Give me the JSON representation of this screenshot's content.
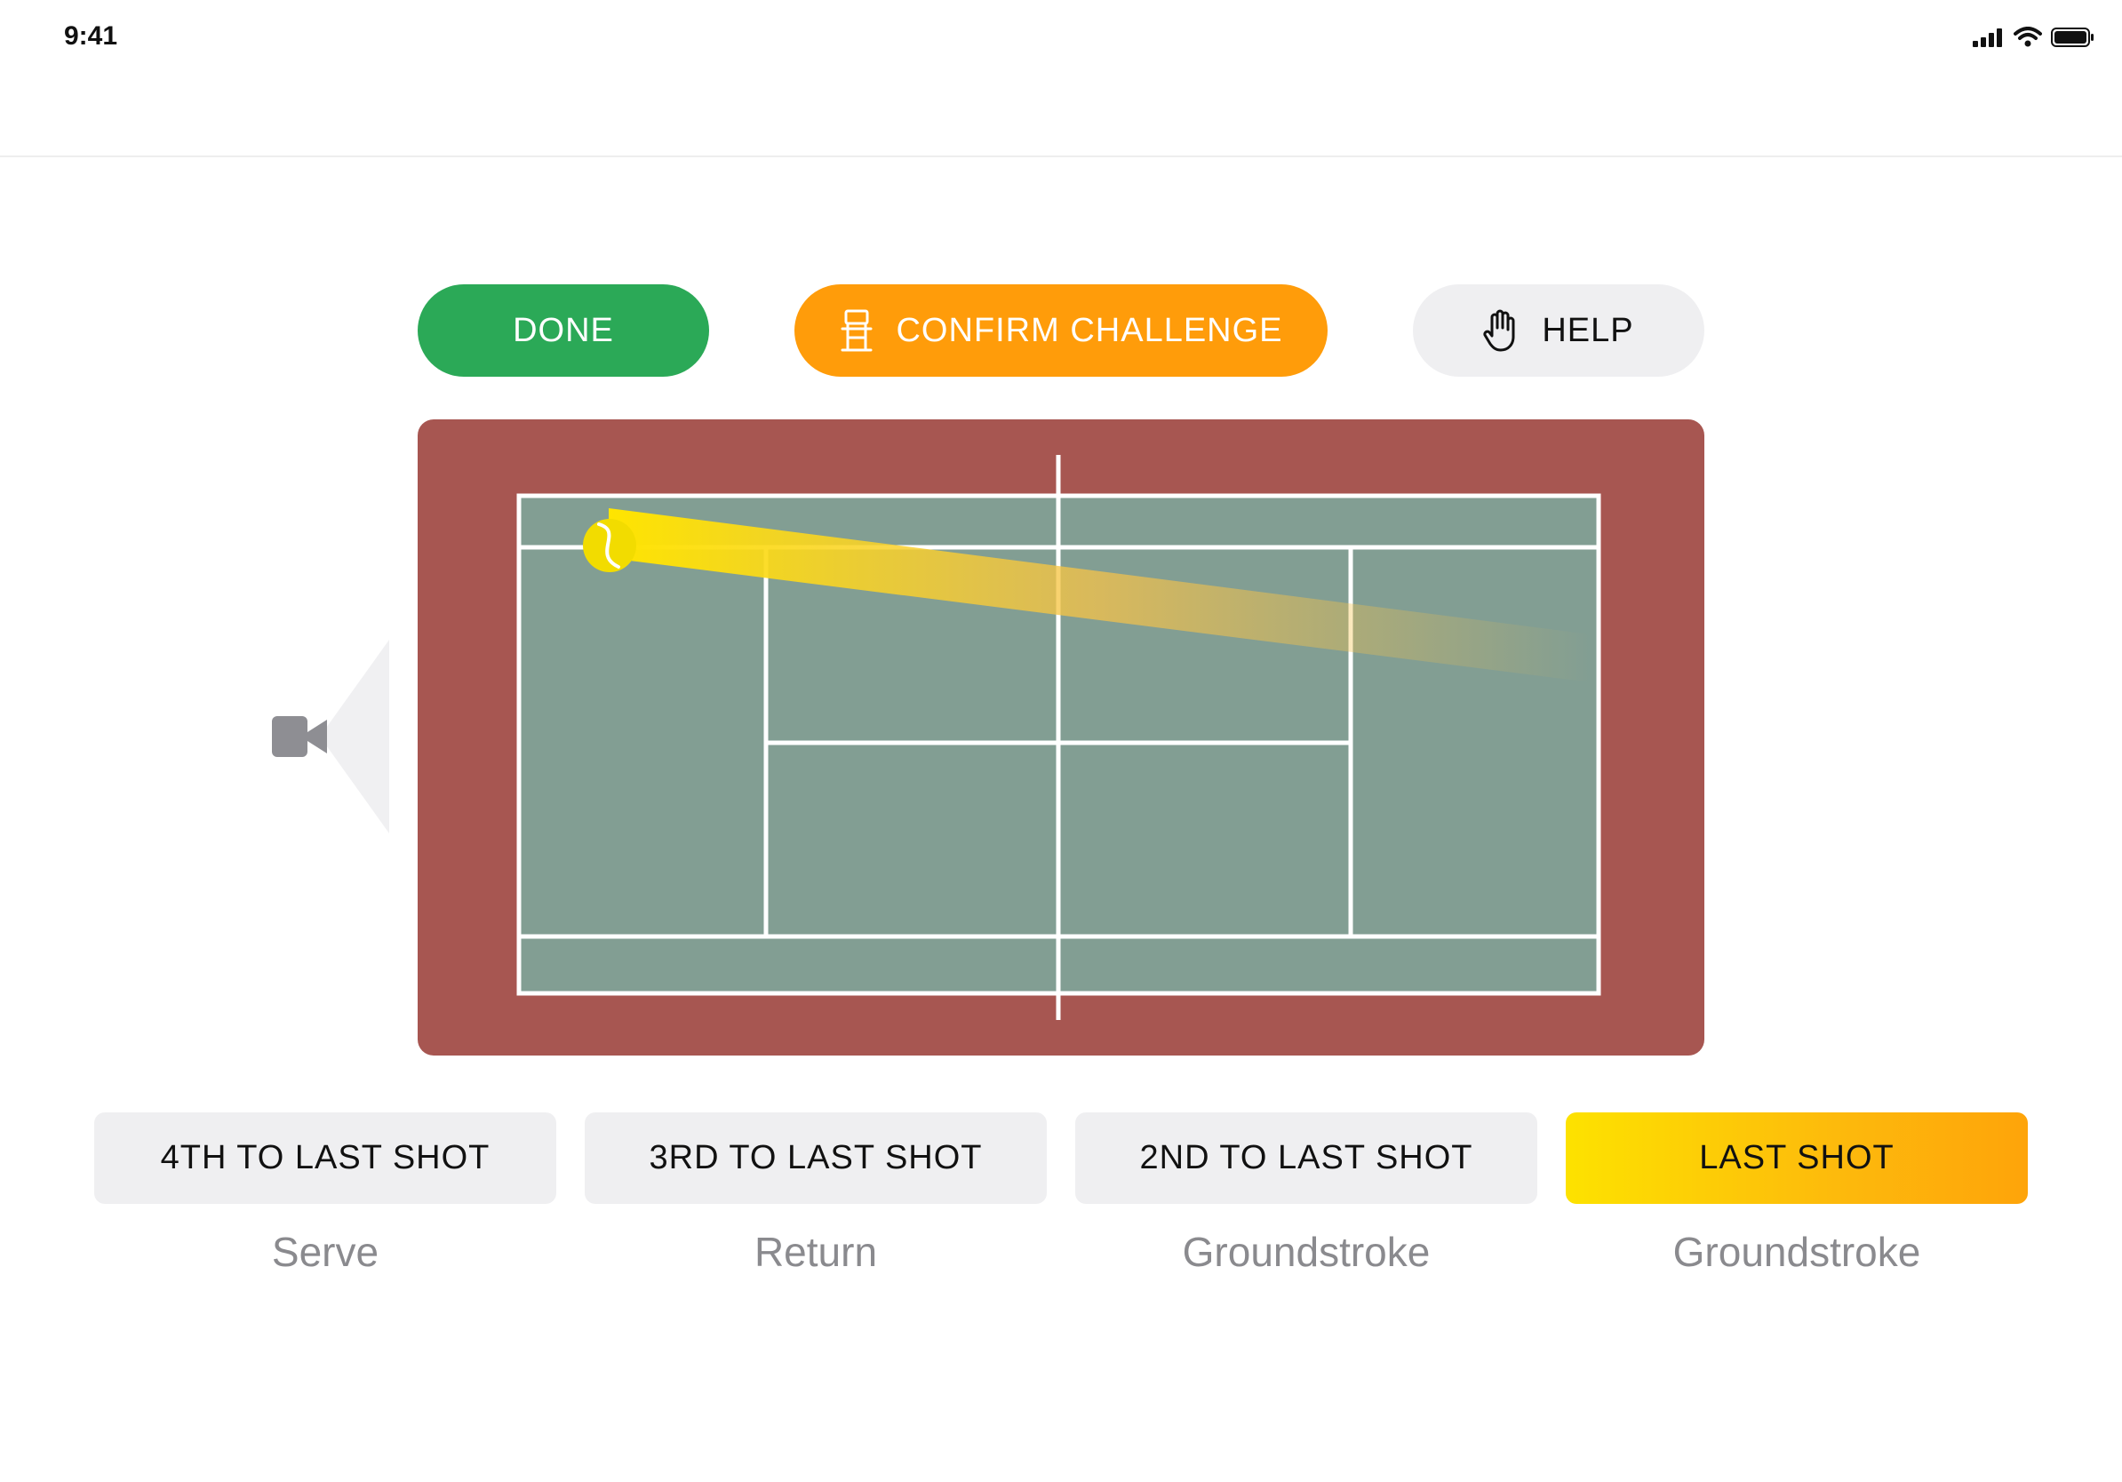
{
  "status_bar": {
    "time": "9:41"
  },
  "toolbar": {
    "done_label": "DONE",
    "confirm_label": "CONFIRM CHALLENGE",
    "help_label": "HELP"
  },
  "court": {
    "colors": {
      "surround": "#a75651",
      "surface": "#829e93",
      "lines": "#ffffff",
      "ball": "#f2dc00"
    }
  },
  "shots": [
    {
      "label": "4TH TO LAST SHOT",
      "type": "Serve",
      "active": false
    },
    {
      "label": "3RD TO LAST SHOT",
      "type": "Return",
      "active": false
    },
    {
      "label": "2ND TO LAST SHOT",
      "type": "Groundstroke",
      "active": false
    },
    {
      "label": "LAST SHOT",
      "type": "Groundstroke",
      "active": true
    }
  ],
  "icons": [
    "signal-icon",
    "wifi-icon",
    "battery-icon",
    "umpire-chair-icon",
    "hand-icon",
    "video-camera-icon",
    "tennis-ball-icon"
  ]
}
